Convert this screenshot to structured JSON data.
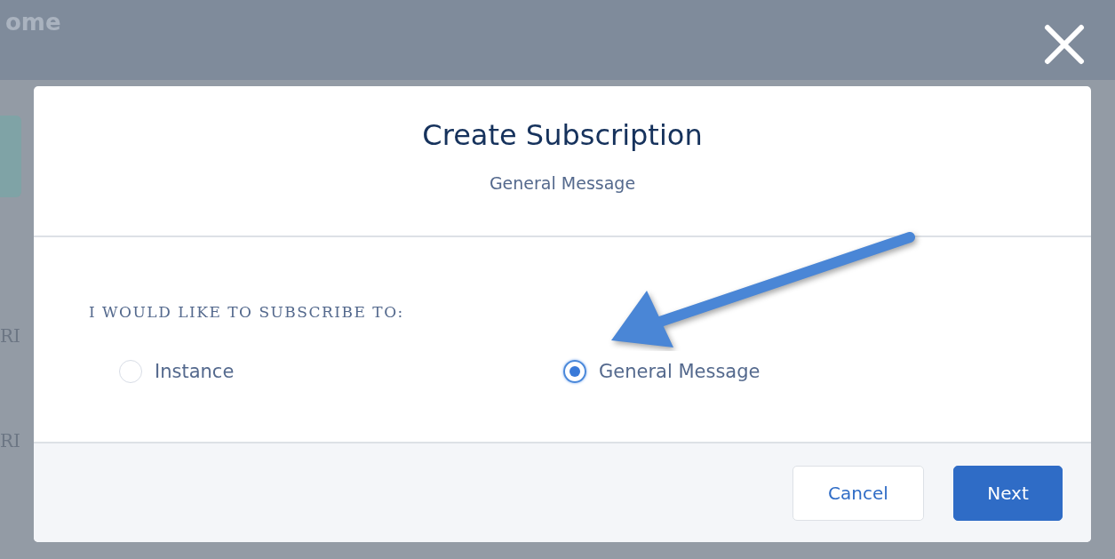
{
  "background": {
    "page_title": "ome",
    "side_labels": [
      "RI",
      "RI"
    ]
  },
  "modal": {
    "title": "Create Subscription",
    "subtitle": "General Message",
    "prompt": "I WOULD LIKE TO SUBSCRIBE TO:",
    "options": [
      {
        "label": "Instance",
        "selected": false
      },
      {
        "label": "General Message",
        "selected": true
      }
    ],
    "buttons": [
      {
        "label": "Cancel",
        "kind": "neutral"
      },
      {
        "label": "Next",
        "kind": "brand"
      }
    ]
  }
}
